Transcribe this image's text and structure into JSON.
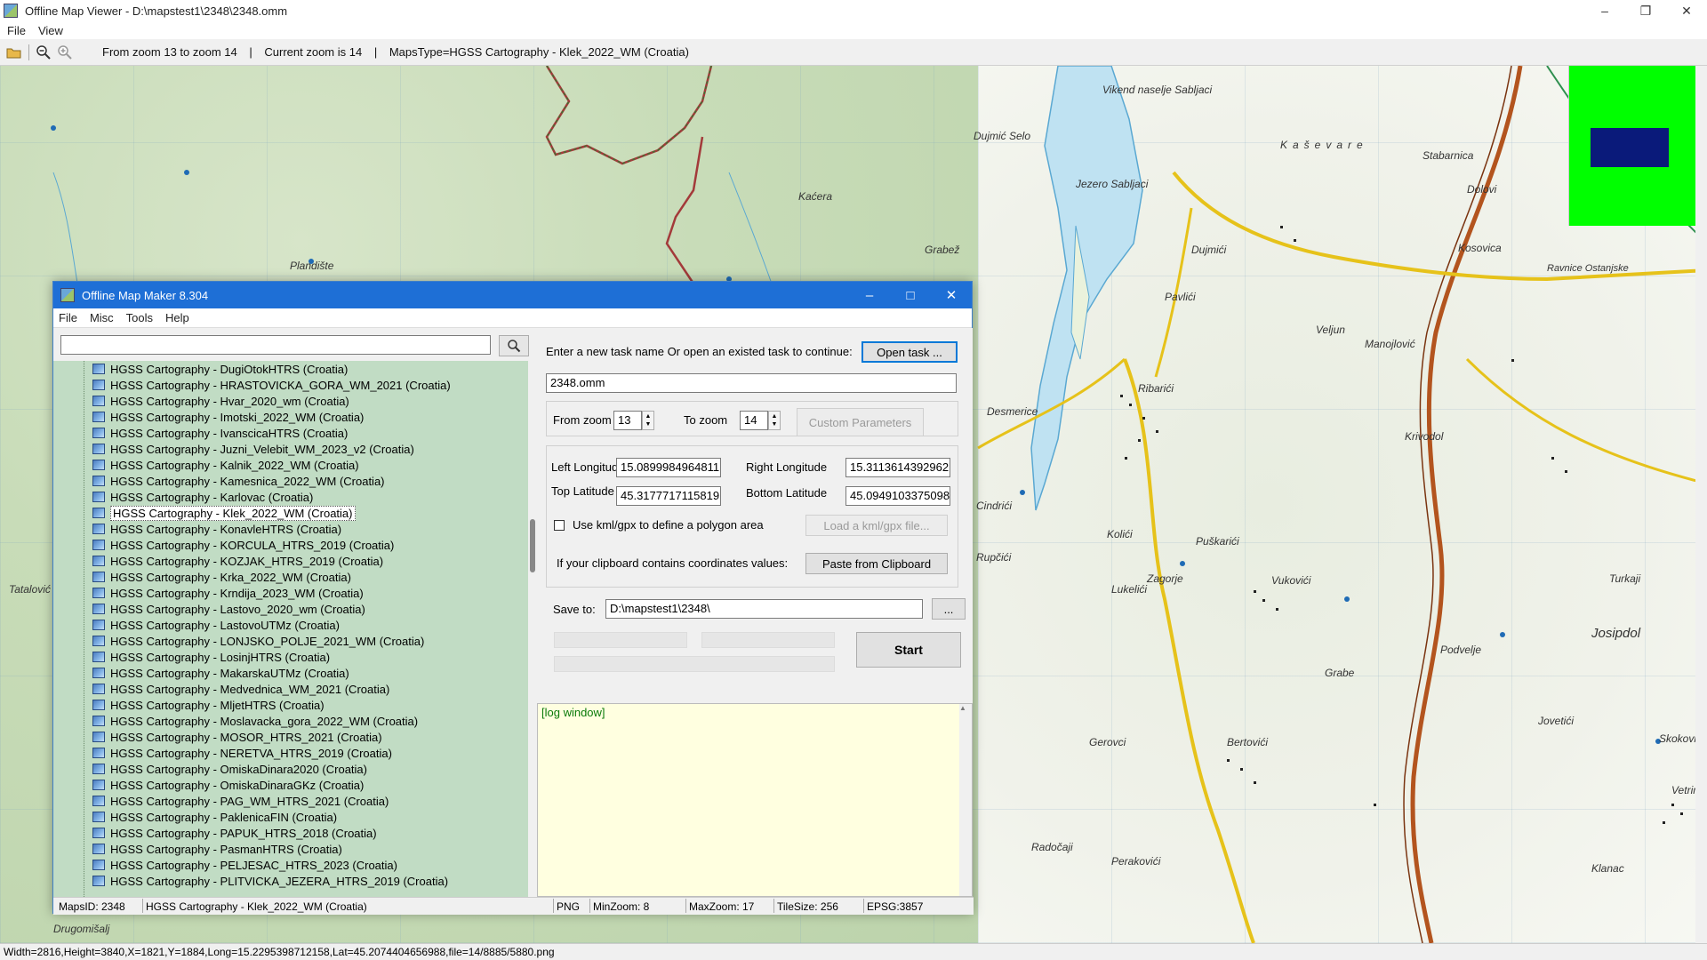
{
  "viewer": {
    "title": "Offline Map Viewer - D:\\mapstest1\\2348\\2348.omm",
    "menu": [
      "File",
      "View"
    ],
    "toolbar": {
      "zoom_range": "From zoom 13 to zoom 14",
      "current_zoom": "Current zoom is 14",
      "maps_type": "MapsType=HGSS Cartography - Klek_2022_WM (Croatia)",
      "sep1": "|",
      "sep2": "|"
    },
    "status": "Width=2816,Height=3840,X=1821,Y=1884,Long=15.2295398712158,Lat=45.2074404656988,file=14/8885/5880.png"
  },
  "map_labels": {
    "l1": "Vikend naselje Sabljaci",
    "l2": "Jezero Sabljaci",
    "l3": "Dujmić Selo",
    "l4": "Kaševare",
    "l5": "Stabarnica",
    "l6": "Dolovi",
    "l7": "Dujmići",
    "l8": "Pavlići",
    "l9": "Ribarići",
    "l10": "Desmerice",
    "l11": "Manojlović",
    "l12": "Krivodol",
    "l13": "Zagorje",
    "l14": "Puškarići",
    "l15": "Vukovići",
    "l16": "Josipdol",
    "l17": "Gerovci",
    "l18": "Bertovići",
    "l19": "Klanac",
    "l20": "Skokovi",
    "l21": "Plandište",
    "l22": "Grabež",
    "l23": "Kaćera",
    "l24": "Kosovica",
    "l25": "Ravnice Ostanjske",
    "l26": "Cindrići",
    "l27": "Rupčići",
    "l28": "Tatalović",
    "l29": "Drugomišalj",
    "l30": "Radočaji",
    "l31": "Perakovići",
    "l32": "Podvelje",
    "l33": "Turkaji",
    "l34": "Veljun",
    "l35": "Lukelići",
    "l36": "Kolići",
    "l37": "Grabe",
    "l38": "Jovetići",
    "l39": "Vetrine"
  },
  "maker": {
    "title": "Offline Map Maker 8.304",
    "menu": [
      "File",
      "Misc",
      "Tools",
      "Help"
    ],
    "search_placeholder": "",
    "tree": [
      "HGSS Cartography - DugiOtokHTRS (Croatia)",
      "HGSS Cartography - HRASTOVICKA_GORA_WM_2021 (Croatia)",
      "HGSS Cartography - Hvar_2020_wm (Croatia)",
      "HGSS Cartography - Imotski_2022_WM (Croatia)",
      "HGSS Cartography - IvanscicaHTRS (Croatia)",
      "HGSS Cartography - Juzni_Velebit_WM_2023_v2 (Croatia)",
      "HGSS Cartography - Kalnik_2022_WM (Croatia)",
      "HGSS Cartography - Kamesnica_2022_WM (Croatia)",
      "HGSS Cartography - Karlovac (Croatia)",
      "HGSS Cartography - Klek_2022_WM (Croatia)",
      "HGSS Cartography - KonavleHTRS (Croatia)",
      "HGSS Cartography - KORCULA_HTRS_2019 (Croatia)",
      "HGSS Cartography - KOZJAK_HTRS_2019 (Croatia)",
      "HGSS Cartography - Krka_2022_WM (Croatia)",
      "HGSS Cartography - Krndija_2023_WM (Croatia)",
      "HGSS Cartography - Lastovo_2020_wm (Croatia)",
      "HGSS Cartography - LastovoUTMz (Croatia)",
      "HGSS Cartography - LONJSKO_POLJE_2021_WM (Croatia)",
      "HGSS Cartography - LosinjHTRS (Croatia)",
      "HGSS Cartography - MakarskaUTMz (Croatia)",
      "HGSS Cartography - Medvednica_WM_2021 (Croatia)",
      "HGSS Cartography - MljetHTRS (Croatia)",
      "HGSS Cartography - Moslavacka_gora_2022_WM (Croatia)",
      "HGSS Cartography - MOSOR_HTRS_2021 (Croatia)",
      "HGSS Cartography - NERETVA_HTRS_2019 (Croatia)",
      "HGSS Cartography - OmiskaDinara2020 (Croatia)",
      "HGSS Cartography - OmiskaDinaraGKz (Croatia)",
      "HGSS Cartography - PAG_WM_HTRS_2021 (Croatia)",
      "HGSS Cartography - PaklenicaFIN (Croatia)",
      "HGSS Cartography - PAPUK_HTRS_2018 (Croatia)",
      "HGSS Cartography - PasmanHTRS (Croatia)",
      "HGSS Cartography - PELJESAC_HTRS_2023 (Croatia)",
      "HGSS Cartography - PLITVICKA_JEZERA_HTRS_2019 (Croatia)"
    ],
    "task_prompt": "Enter a new task name Or open an existed task to continue:",
    "open_task": "Open task ...",
    "task_name": "2348.omm",
    "from_zoom_label": "From zoom",
    "from_zoom": "13",
    "to_zoom_label": "To zoom",
    "to_zoom": "14",
    "custom_params": "Custom Parameters",
    "left_lon_label": "Left Longitude",
    "left_lon": "15.0899984964811",
    "right_lon_label": "Right Longitude",
    "right_lon": "15.3113614392962",
    "top_lat_label": "Top Latitude",
    "top_lat": "45.3177717115819",
    "bottom_lat_label": "Bottom Latitude",
    "bottom_lat": "45.0949103375098",
    "kml_label": "Use kml/gpx to define a polygon area",
    "kml_button": "Load a kml/gpx file...",
    "clipboard_label": "If your clipboard contains coordinates values:",
    "clipboard_button": "Paste from Clipboard",
    "save_label": "Save to:",
    "save_path": "D:\\mapstest1\\2348\\",
    "browse": "...",
    "start": "Start",
    "log": "[log window]",
    "status": {
      "maps_id": "MapsID: 2348",
      "maps_name": "HGSS Cartography - Klek_2022_WM (Croatia)",
      "format": "PNG",
      "min_zoom": "MinZoom: 8",
      "max_zoom": "MaxZoom: 17",
      "tile_size": "TileSize: 256",
      "epsg": "EPSG:3857"
    }
  }
}
